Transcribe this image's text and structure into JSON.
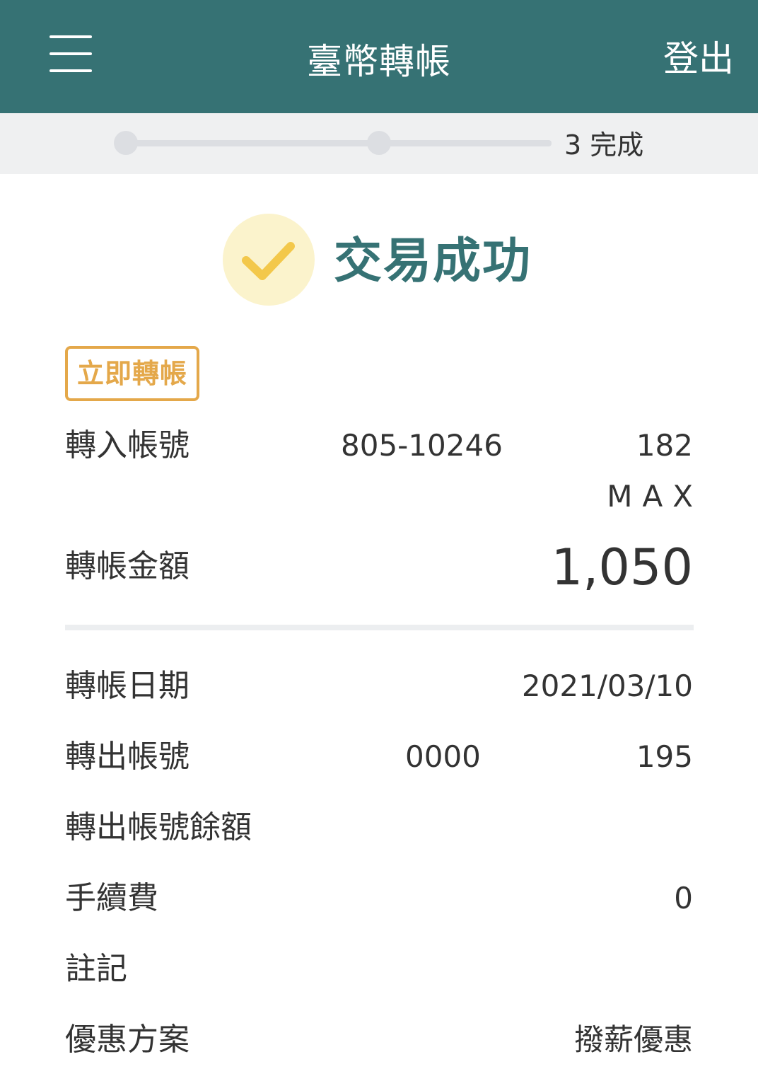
{
  "header": {
    "title": "臺幣轉帳",
    "logout_label": "登出"
  },
  "steps": {
    "current_label": "3 完成"
  },
  "result": {
    "status_text": "交易成功"
  },
  "badge": {
    "label": "立即轉帳"
  },
  "transfer_in": {
    "label": "轉入帳號",
    "account_part1": "805-10246",
    "account_part2": "182",
    "account_name": "MAX"
  },
  "amount": {
    "label": "轉帳金額",
    "value": "1,050"
  },
  "details": {
    "date_label": "轉帳日期",
    "date_value": "2021/03/10",
    "from_label": "轉出帳號",
    "from_part1": "0000",
    "from_part2": "195",
    "balance_label": "轉出帳號餘額",
    "fee_label": "手續費",
    "fee_value": "0",
    "memo_label": "註記",
    "promo_label": "優惠方案",
    "promo_value": "撥薪優惠"
  },
  "colors": {
    "header_bg": "#367274",
    "accent_teal": "#367274",
    "badge_orange": "#e4a84a",
    "check_yellow": "#f3c84b",
    "check_circle_bg": "#fbf3cc"
  },
  "icons": {
    "menu": "hamburger-menu-icon",
    "check": "checkmark-icon"
  }
}
